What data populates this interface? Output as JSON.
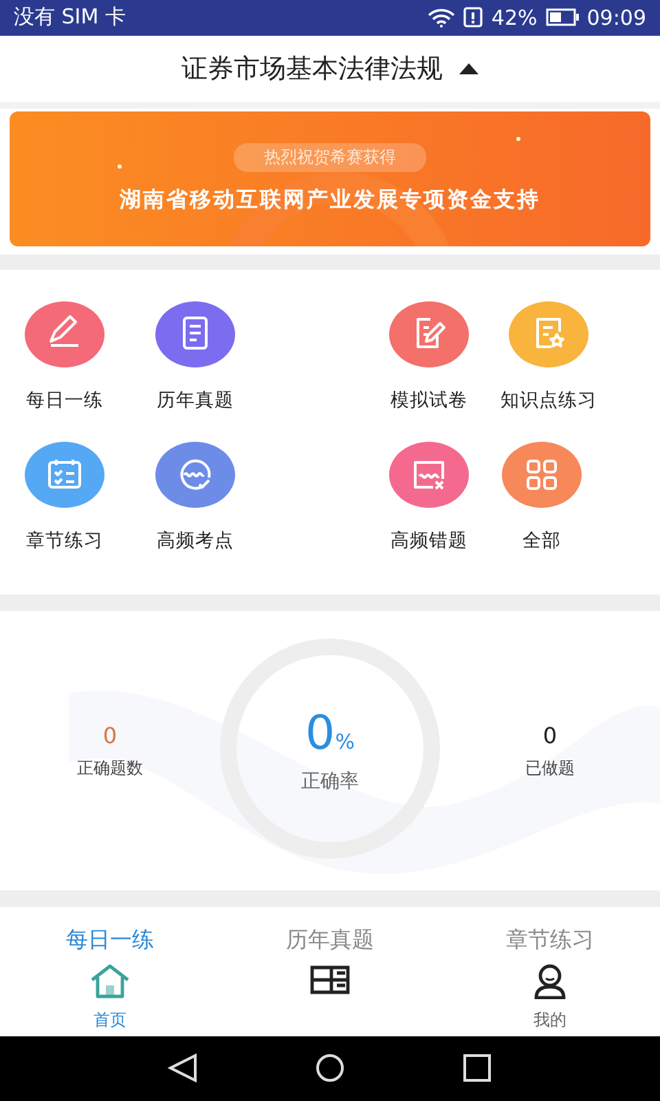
{
  "status_bar": {
    "carrier": "没有 SIM 卡",
    "battery": "42%",
    "time": "09:09"
  },
  "header": {
    "title": "证券市场基本法律法规",
    "expanded": true
  },
  "banner": {
    "subtitle": "热烈祝贺希赛获得",
    "headline": "湖南省移动互联网产业发展专项资金支持"
  },
  "features": [
    {
      "label": "每日一练",
      "kind": "pencil",
      "color": "#f46a78"
    },
    {
      "label": "历年真题",
      "kind": "clipboard",
      "color": "#7b6cf0"
    },
    {
      "label": "模拟试卷",
      "kind": "edit",
      "color": "#f4706a"
    },
    {
      "label": "知识点练习",
      "kind": "star-doc",
      "color": "#f8b43c"
    },
    {
      "label": "章节练习",
      "kind": "checklist",
      "color": "#55a8f4"
    },
    {
      "label": "高频考点",
      "kind": "wave-check",
      "color": "#6d8ce8"
    },
    {
      "label": "高频错题",
      "kind": "wave-x",
      "color": "#f46a8e"
    },
    {
      "label": "全部",
      "kind": "grid",
      "color": "#f6885a"
    }
  ],
  "stats": {
    "correct_count": {
      "value": "0",
      "label": "正确题数"
    },
    "accuracy": {
      "value": "0",
      "unit": "%",
      "label": "正确率"
    },
    "done_count": {
      "value": "0",
      "label": "已做题"
    }
  },
  "practice_tabs": [
    {
      "label": "每日一练",
      "selected": true
    },
    {
      "label": "历年真题",
      "selected": false
    },
    {
      "label": "章节练习",
      "selected": false
    }
  ],
  "bottom_nav": [
    {
      "label": "首页",
      "kind": "home",
      "selected": true
    },
    {
      "kind": "book",
      "selected": false
    },
    {
      "label": "我的",
      "kind": "person",
      "selected": false
    }
  ]
}
